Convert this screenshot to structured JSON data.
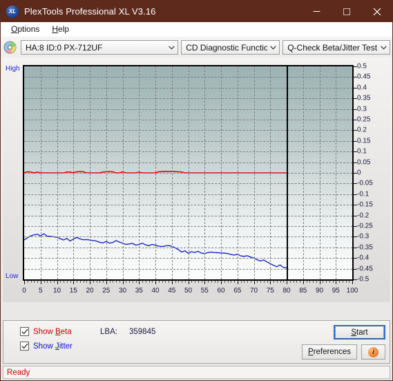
{
  "window": {
    "title": "PlexTools Professional XL V3.16",
    "app_icon": "XL",
    "minimize_label": "minimize-icon",
    "maximize_label": "maximize-icon",
    "close_label": "close-icon"
  },
  "menu": {
    "items": [
      {
        "label": "Options",
        "accel": "O"
      },
      {
        "label": "Help",
        "accel": "H"
      }
    ]
  },
  "toolbar": {
    "drive_combo": {
      "value": "HA:8 ID:0  PX-712UF",
      "arrow": "⌄"
    },
    "function_combo": {
      "value": "CD Diagnostic Functions",
      "arrow": "⌄"
    },
    "test_combo": {
      "value": "Q-Check Beta/Jitter Test",
      "arrow": "⌄"
    }
  },
  "chart_data": {
    "type": "line",
    "title": "Q-Check Beta/Jitter Test",
    "xlabel": "",
    "ylabel": "",
    "xlim": [
      0,
      100
    ],
    "ylim": [
      -0.5,
      0.5
    ],
    "grid": true,
    "legend": "none",
    "y_axis_high_label": "High",
    "y_axis_low_label": "Low",
    "data_end_marker_x": 80,
    "xticks": [
      0,
      5,
      10,
      15,
      20,
      25,
      30,
      35,
      40,
      45,
      50,
      55,
      60,
      65,
      70,
      75,
      80,
      85,
      90,
      95,
      100
    ],
    "yticks": [
      0.5,
      0.45,
      0.4,
      0.35,
      0.3,
      0.25,
      0.2,
      0.15,
      0.1,
      0.05,
      0,
      -0.05,
      -0.1,
      -0.15,
      -0.2,
      -0.25,
      -0.3,
      -0.35,
      -0.4,
      -0.45,
      -0.5
    ],
    "ytick_labels": [
      "0.5",
      "0.45",
      "0.4",
      "0.35",
      "0.3",
      "0.25",
      "0.2",
      "0.15",
      "0.1",
      "0.05",
      "0",
      "-0.05",
      "-0.1",
      "-0.15",
      "-0.2",
      "-0.25",
      "-0.3",
      "-0.35",
      "-0.4",
      "-0.45",
      "-0.5"
    ],
    "series": [
      {
        "name": "Beta",
        "color": "#ee0000",
        "x": [
          0,
          1,
          2,
          3,
          4,
          5,
          6,
          7,
          8,
          9,
          10,
          11,
          12,
          13,
          14,
          15,
          16,
          17,
          18,
          19,
          20,
          21,
          22,
          23,
          24,
          25,
          26,
          27,
          28,
          29,
          30,
          31,
          32,
          33,
          34,
          35,
          36,
          37,
          38,
          39,
          40,
          41,
          42,
          43,
          44,
          45,
          46,
          47,
          48,
          49,
          50,
          51,
          52,
          53,
          54,
          55,
          56,
          57,
          58,
          59,
          60,
          61,
          62,
          63,
          64,
          65,
          66,
          67,
          68,
          69,
          70,
          71,
          72,
          73,
          74,
          75,
          76,
          77,
          78,
          79,
          80
        ],
        "values": [
          0,
          0.005,
          0.004,
          0,
          0.004,
          0,
          0,
          0,
          0,
          0,
          0,
          0,
          0,
          0.004,
          0.004,
          0,
          0.005,
          0.006,
          0.005,
          0,
          0,
          0,
          0,
          0,
          0.004,
          0.005,
          0.006,
          0.005,
          0,
          0,
          0.005,
          0,
          0,
          0,
          0,
          0.004,
          0,
          0,
          0,
          0,
          0,
          0.005,
          0.006,
          0.007,
          0.006,
          0.007,
          0.006,
          0.005,
          0.004,
          0,
          0,
          0,
          0,
          0,
          0,
          0,
          0,
          0,
          0,
          0,
          0,
          0,
          0,
          0,
          0,
          0,
          0,
          0,
          0,
          0,
          0,
          0,
          0,
          0,
          0,
          0,
          0,
          0,
          0,
          0,
          0
        ]
      },
      {
        "name": "Jitter",
        "color": "#1b27c4",
        "x": [
          0,
          1,
          2,
          3,
          4,
          5,
          6,
          7,
          8,
          9,
          10,
          11,
          12,
          13,
          14,
          15,
          16,
          17,
          18,
          19,
          20,
          21,
          22,
          23,
          24,
          25,
          26,
          27,
          28,
          29,
          30,
          31,
          32,
          33,
          34,
          35,
          36,
          37,
          38,
          39,
          40,
          41,
          42,
          43,
          44,
          45,
          46,
          47,
          48,
          49,
          50,
          51,
          52,
          53,
          54,
          55,
          56,
          57,
          58,
          59,
          60,
          61,
          62,
          63,
          64,
          65,
          66,
          67,
          68,
          69,
          70,
          71,
          72,
          73,
          74,
          75,
          76,
          77,
          78,
          79,
          80
        ],
        "values": [
          -0.315,
          -0.305,
          -0.296,
          -0.291,
          -0.288,
          -0.296,
          -0.286,
          -0.297,
          -0.298,
          -0.3,
          -0.302,
          -0.309,
          -0.315,
          -0.308,
          -0.32,
          -0.311,
          -0.303,
          -0.31,
          -0.314,
          -0.313,
          -0.315,
          -0.318,
          -0.32,
          -0.326,
          -0.329,
          -0.322,
          -0.33,
          -0.327,
          -0.318,
          -0.325,
          -0.33,
          -0.336,
          -0.334,
          -0.331,
          -0.339,
          -0.337,
          -0.33,
          -0.338,
          -0.342,
          -0.336,
          -0.34,
          -0.344,
          -0.346,
          -0.343,
          -0.341,
          -0.345,
          -0.352,
          -0.36,
          -0.372,
          -0.366,
          -0.378,
          -0.37,
          -0.374,
          -0.368,
          -0.377,
          -0.379,
          -0.374,
          -0.372,
          -0.374,
          -0.375,
          -0.376,
          -0.377,
          -0.379,
          -0.383,
          -0.386,
          -0.382,
          -0.39,
          -0.392,
          -0.389,
          -0.395,
          -0.4,
          -0.408,
          -0.414,
          -0.409,
          -0.418,
          -0.426,
          -0.434,
          -0.441,
          -0.432,
          -0.444,
          -0.446
        ]
      }
    ]
  },
  "controls": {
    "show_beta": {
      "label_prefix": "Show ",
      "label_accel": "B",
      "label_suffix": "eta",
      "checked": true
    },
    "show_jitter": {
      "label_prefix": "Show ",
      "label_accel": "J",
      "label_suffix": "itter",
      "checked": true
    },
    "lba_label": "LBA:",
    "lba_value": "359845",
    "start_button": {
      "prefix": "",
      "accel": "S",
      "suffix": "tart"
    },
    "preferences_button": {
      "prefix": "",
      "accel": "P",
      "suffix": "references"
    },
    "info_button": "i"
  },
  "status": {
    "text": "Ready"
  },
  "colors": {
    "titlebar": "#5e2a1c",
    "beta": "#ee0000",
    "jitter": "#1b27c4",
    "accent_focus": "#2b6fd0",
    "status_text": "#cc0000"
  }
}
